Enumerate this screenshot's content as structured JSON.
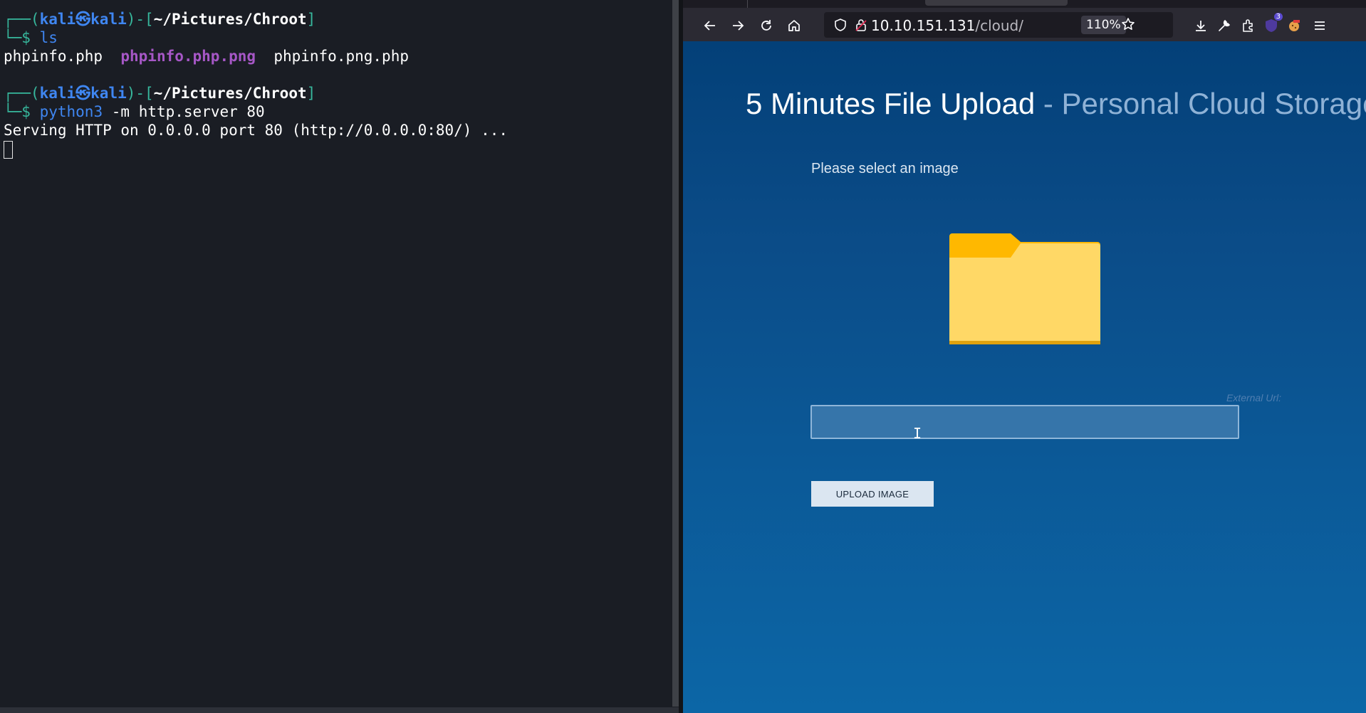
{
  "terminal": {
    "prompt1": {
      "frame_open": "┌──(",
      "user": "kali",
      "at_icon": "㉿",
      "host": "kali",
      "frame_mid": ")-[",
      "path": "~/Pictures/Chroot",
      "frame_close": "]",
      "prompt_marker": "└─$",
      "command": "ls"
    },
    "ls_output": {
      "file1": "phpinfo.php",
      "file2": "phpinfo.php.png",
      "file3": "phpinfo.png.php"
    },
    "prompt2": {
      "frame_open": "┌──(",
      "user": "kali",
      "at_icon": "㉿",
      "host": "kali",
      "frame_mid": ")-[",
      "path": "~/Pictures/Chroot",
      "frame_close": "]",
      "prompt_marker": "└─$",
      "command": "python3",
      "args": "-m http.server 80"
    },
    "server_output": "Serving HTTP on 0.0.0.0 port 80 (http://0.0.0.0:80/) ..."
  },
  "browser": {
    "url_host": "10.10.151.131",
    "url_path": "/cloud/",
    "zoom": "110%",
    "extension_badge": "3",
    "icons": [
      "back-icon",
      "forward-icon",
      "reload-icon",
      "home-icon",
      "shield-icon",
      "lock-icon",
      "star-icon",
      "download-icon",
      "wrench-icon",
      "extensions-icon",
      "ublock-icon",
      "cookie-icon",
      "menu-icon"
    ]
  },
  "page": {
    "heading_main": "5 Minutes File Upload",
    "heading_sub": " - Personal Cloud Storage",
    "select_label": "Please select an image",
    "external_url_label": "External Url:",
    "url_input_value": "",
    "upload_button": "UPLOAD IMAGE"
  },
  "colors": {
    "terminal_bg": "#1a1d24",
    "prompt_frame": "#37b89d",
    "prompt_user": "#3f86f1",
    "png_file": "#a657c6",
    "page_bg_top": "#034078",
    "page_bg_bottom": "#0c66a6",
    "folder_front": "#ffd866",
    "folder_tab": "#ffb800"
  }
}
